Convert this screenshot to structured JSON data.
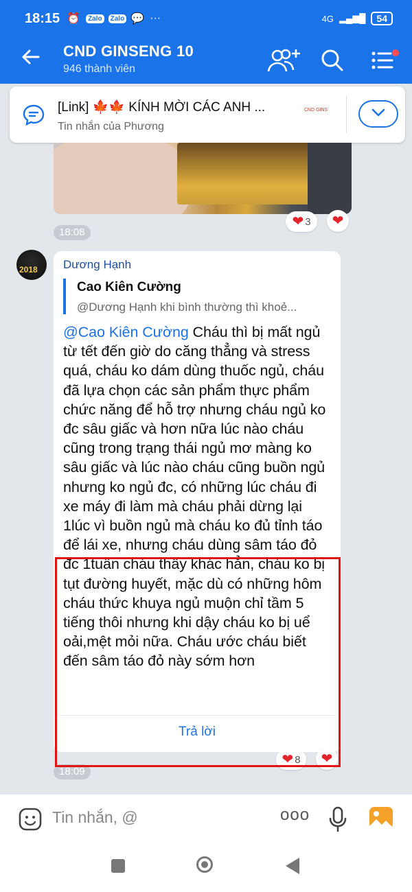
{
  "status_bar": {
    "time": "18:15",
    "app_badges": [
      "Zalo",
      "Zalo"
    ],
    "overflow": "···",
    "network": "4G",
    "battery": "54"
  },
  "header": {
    "back_icon": "arrow-left-icon",
    "title": "CND GINSENG 10",
    "subtitle": "946 thành viên"
  },
  "pinned": {
    "text": "[Link] 🍁🍁  KÍNH MỜI CÁC ANH ...",
    "sender": "Tin nhắn của Phương",
    "thumb_text": "CND GINS"
  },
  "photo_message": {
    "reaction_count": "3",
    "time": "18:08"
  },
  "message": {
    "sender": "Dương Hạnh",
    "quote_name": "Cao Kiên Cường",
    "quote_text": "@Dương Hạnh khi bình thường thì  khoẻ...",
    "mention": "@Cao Kiên Cường",
    "body": " Cháu thì bị mất ngủ từ tết đến giờ do căng thẳng và stress quá, cháu ko dám dùng thuốc ngủ, cháu đã lựa chọn các sản phẩm thực phẩm chức năng để hỗ trợ nhưng cháu ngủ ko đc sâu giấc và hơn nữa lúc nào cháu cũng trong trạng thái ngủ mơ màng ko sâu giấc và lúc nào cháu cũng buồn ngủ nhưng ko ngủ đc, có những lúc cháu đi xe máy đi làm mà cháu phải dừng lại 1lúc vì buồn ngủ mà cháu ko đủ tỉnh táo để lái xe, nhưng cháu dùng sâm táo đỏ đc 1tuần cháu thấy khác hẳn, cháu ko bị tụt đường huyết, mặc dù có những hôm cháu thức khuya ngủ muộn chỉ tầm 5 tiếng thôi nhưng khi dậy cháu ko bị uể oải,mệt mỏi nữa. Cháu ước cháu biết đến sâm táo đỏ này sớm hơn",
    "reply_label": "Trả lời",
    "reaction_count": "8",
    "time": "18:09"
  },
  "input_bar": {
    "placeholder": "Tin nhắn, @",
    "more": "ooo"
  },
  "colors": {
    "brand": "#1a73e8",
    "highlight": "#e31313",
    "heart": "#e3242b"
  }
}
